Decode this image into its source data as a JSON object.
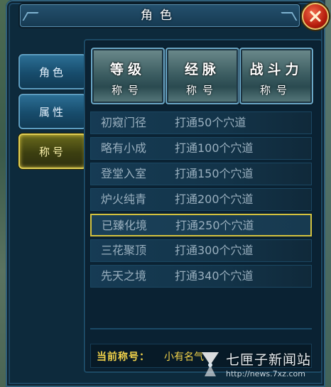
{
  "window": {
    "title": "角色"
  },
  "tabs": [
    {
      "label": "角色",
      "active": false
    },
    {
      "label": "属性",
      "active": false
    },
    {
      "label": "称号",
      "active": true
    }
  ],
  "categories": [
    {
      "line1": "等级",
      "line2": "称号"
    },
    {
      "line1": "经脉",
      "line2": "称号"
    },
    {
      "line1": "战斗力",
      "line2": "称号"
    }
  ],
  "titles": [
    {
      "name": "初窥门径",
      "requirement": "打通50个穴道"
    },
    {
      "name": "略有小成",
      "requirement": "打通100个穴道"
    },
    {
      "name": "登堂入室",
      "requirement": "打通150个穴道"
    },
    {
      "name": "炉火纯青",
      "requirement": "打通200个穴道"
    },
    {
      "name": "已臻化境",
      "requirement": "打通250个穴道",
      "selected": true
    },
    {
      "name": "三花聚顶",
      "requirement": "打通300个穴道"
    },
    {
      "name": "先天之境",
      "requirement": "打通340个穴道"
    }
  ],
  "current": {
    "label": "当前称号：",
    "value": "小有名气"
  },
  "watermark": {
    "name": "七匣子新闻站",
    "url": "http://news.7xz.com"
  },
  "colors": {
    "accent_gold": "#f2d34a",
    "selected_border": "#d4c23e",
    "close_red": "#b61d0d"
  }
}
